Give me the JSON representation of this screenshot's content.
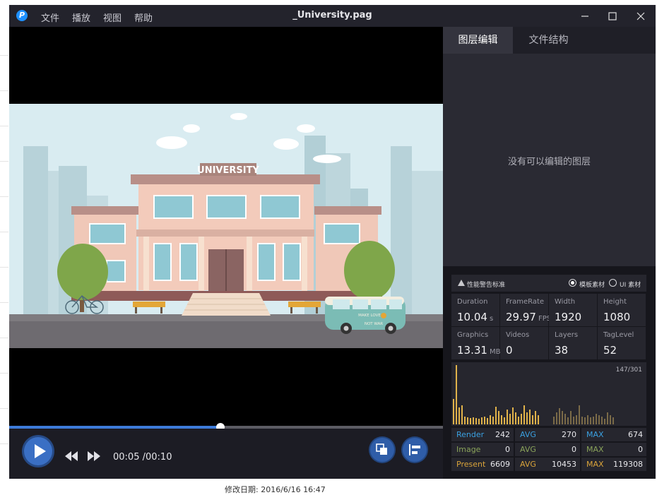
{
  "window": {
    "title": "_University.pag"
  },
  "menu": {
    "file": "文件",
    "play": "播放",
    "view": "视图",
    "help": "帮助"
  },
  "scene": {
    "sign": "UNIVERSITY",
    "bus_text_1": "MAKE LOVE",
    "bus_text_2": "NOT WAR"
  },
  "player": {
    "current_time": "00:05",
    "separator": "/",
    "total_time": "00:10",
    "progress": 0.487
  },
  "side": {
    "tabs": [
      "图层编辑",
      "文件结构"
    ],
    "active_tab": 0,
    "empty_message": "没有可以编辑的图层"
  },
  "perf": {
    "warning_label": "性能警告标准",
    "option_template": "模板素材",
    "option_ui": "UI 素材",
    "selected_option": "template",
    "stats": [
      {
        "label": "Duration",
        "value": "10.04",
        "unit": "s"
      },
      {
        "label": "FrameRate",
        "value": "29.97",
        "unit": "FPS"
      },
      {
        "label": "Width",
        "value": "1920",
        "unit": ""
      },
      {
        "label": "Height",
        "value": "1080",
        "unit": ""
      },
      {
        "label": "Graphics",
        "value": "13.31",
        "unit": "MB"
      },
      {
        "label": "Videos",
        "value": "0",
        "unit": ""
      },
      {
        "label": "Layers",
        "value": "38",
        "unit": ""
      },
      {
        "label": "TagLevel",
        "value": "52",
        "unit": ""
      }
    ],
    "frame_count": "147/301",
    "frame_bars_highlight": [
      38,
      88,
      25,
      28,
      11,
      10,
      9,
      10,
      9,
      8,
      10,
      11,
      9,
      14,
      12,
      26,
      20,
      14,
      10,
      22,
      16,
      25,
      18,
      12,
      16,
      28,
      18,
      22,
      14,
      20,
      14
    ],
    "frame_bars_dim": [
      12,
      18,
      24,
      20,
      16,
      10,
      20,
      12,
      14,
      28,
      12,
      10,
      14,
      10,
      12,
      16,
      14,
      12,
      8,
      18,
      14,
      10
    ],
    "metrics": [
      {
        "name": "Render",
        "value": "242",
        "avg_label": "AVG",
        "avg": "270",
        "max_label": "MAX",
        "max": "674",
        "name_color": "#3aa0e0",
        "avg_color": "#3aa0e0",
        "max_color": "#3aa0e0"
      },
      {
        "name": "Image",
        "value": "0",
        "avg_label": "AVG",
        "avg": "0",
        "max_label": "MAX",
        "max": "0",
        "name_color": "#8aa35a",
        "avg_color": "#8aa35a",
        "max_color": "#8aa35a"
      },
      {
        "name": "Present",
        "value": "6609",
        "avg_label": "AVG",
        "avg": "10453",
        "max_label": "MAX",
        "max": "119308",
        "name_color": "#d9a33a",
        "avg_color": "#d9a33a",
        "max_color": "#d9a33a"
      }
    ]
  },
  "colors": {
    "accent": "#3d7bd9",
    "bar_highlight": "#e0b24a",
    "bar_dim": "#7a6a48"
  },
  "background": {
    "footer_text": "修改日期: 2016/6/16 16:47"
  }
}
